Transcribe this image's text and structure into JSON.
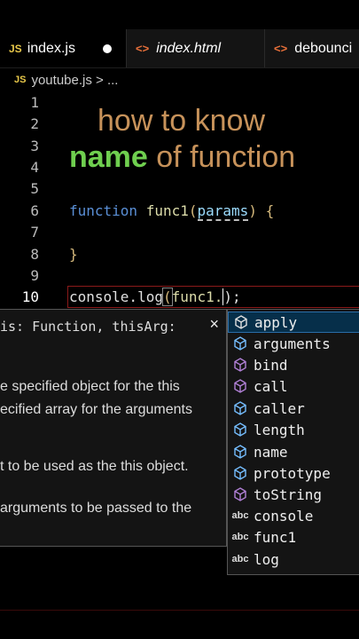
{
  "tabs": [
    {
      "badge": "JS",
      "label": "index.js"
    },
    {
      "badge": "<>",
      "label": "index.html"
    },
    {
      "badge": "<>",
      "label": "debounci"
    }
  ],
  "breadcrumb": {
    "badge": "JS",
    "text": "youtube.js > ..."
  },
  "line_numbers": [
    "1",
    "2",
    "3",
    "4",
    "5",
    "6",
    "7",
    "8",
    "9",
    "10"
  ],
  "overlay": {
    "line1": "how to know",
    "line2_green": "name",
    "line2_rest": " of function"
  },
  "code": {
    "l6_kw": "function",
    "l6_name": "func1",
    "l6_open": "(",
    "l6_param": "params",
    "l6_close": ")",
    "l6_brace": " {",
    "l8_brace": "}",
    "l10_a": "console.log",
    "l10_paren": "(",
    "l10_b": "func1.",
    "l10_c": ");"
  },
  "signature": {
    "head": "is: Function, thisArg:",
    "close": "×",
    "lines": [
      "e specified object for the this",
      "ecified array for the arguments",
      "t to be used as the this object.",
      "arguments to be passed to the"
    ]
  },
  "suggestions": [
    {
      "label": "apply",
      "kind": "method"
    },
    {
      "label": "arguments",
      "kind": "property"
    },
    {
      "label": "bind",
      "kind": "method"
    },
    {
      "label": "call",
      "kind": "method"
    },
    {
      "label": "caller",
      "kind": "property"
    },
    {
      "label": "length",
      "kind": "property"
    },
    {
      "label": "name",
      "kind": "property"
    },
    {
      "label": "prototype",
      "kind": "property"
    },
    {
      "label": "toString",
      "kind": "method"
    },
    {
      "label": "console",
      "kind": "text",
      "abc": "abc"
    },
    {
      "label": "func1",
      "kind": "text",
      "abc": "abc"
    },
    {
      "label": "log",
      "kind": "text",
      "abc": "abc"
    }
  ],
  "colors": {
    "method": "#b180d7",
    "property": "#75beff",
    "accent_green": "#6fcf4f",
    "accent_tan": "#c7925a"
  }
}
